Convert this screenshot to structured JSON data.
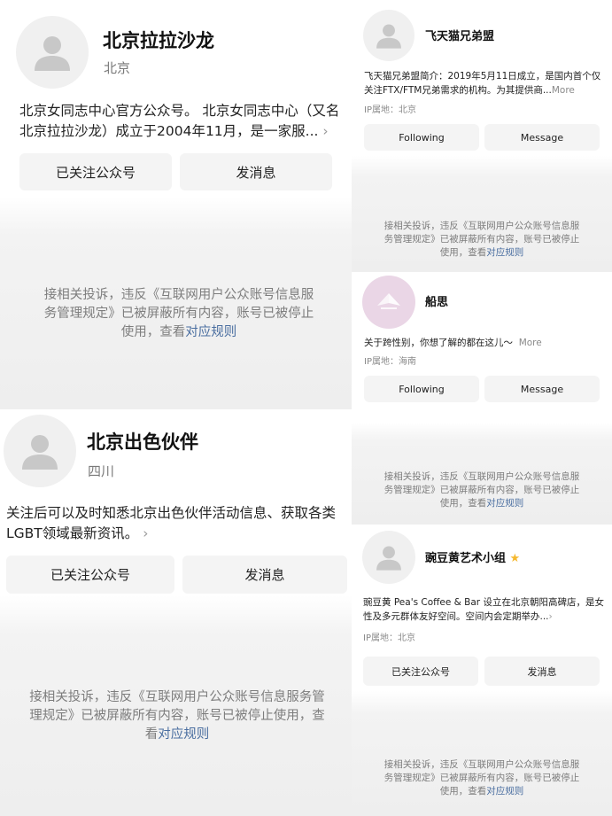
{
  "colors": {
    "link": "#4a6ea0",
    "star": "#f5b82e",
    "notice_bg": "#eeeeee"
  },
  "accounts": [
    {
      "name": "北京拉拉沙龙",
      "region": "北京",
      "description": "北京女同志中心官方公众号。 北京女同志中心（又名北京拉拉沙龙）成立于2004年11月，是一家服...",
      "follow_label": "已关注公众号",
      "message_label": "发消息",
      "notice_text": "接相关投诉，违反《互联网用户公众账号信息服务管理规定》已被屏蔽所有内容，账号已被停止使用，查看",
      "notice_link": "对应规则"
    },
    {
      "name": "北京出色伙伴",
      "region": "四川",
      "description": "关注后可以及时知悉北京出色伙伴活动信息、获取各类LGBT领域最新资讯。",
      "follow_label": "已关注公众号",
      "message_label": "发消息",
      "notice_text": "接相关投诉，违反《互联网用户公众账号信息服务管理规定》已被屏蔽所有内容，账号已被停止使用，查看",
      "notice_link": "对应规则"
    },
    {
      "name": "飞天猫兄弟盟",
      "description": "飞天猫兄弟盟简介：2019年5月11日成立，是国内首个仅关注FTX/FTM兄弟需求的机构。为其提供商...",
      "more": "More",
      "ip_label": "IP属地：北京",
      "follow_label": "Following",
      "message_label": "Message",
      "notice_text": "接相关投诉，违反《互联网用户公众账号信息服务管理规定》已被屏蔽所有内容，账号已被停止使用，查看",
      "notice_link": "对应规则"
    },
    {
      "name": "船思",
      "description": "关于跨性别，你想了解的都在这儿～",
      "more": "More",
      "ip_label": "IP属地：海南",
      "follow_label": "Following",
      "message_label": "Message",
      "notice_text": "接相关投诉，违反《互联网用户公众账号信息服务管理规定》已被屏蔽所有内容，账号已被停止使用，查看",
      "notice_link": "对应规则"
    },
    {
      "name": "豌豆黄艺术小组",
      "description": "豌豆黄 Pea's Coffee & Bar 设立在北京朝阳高碑店，是女性及多元群体友好空间。空间内会定期举办...",
      "ip_label": "IP属地：北京",
      "follow_label": "已关注公众号",
      "message_label": "发消息",
      "notice_text": "接相关投诉，违反《互联网用户公众账号信息服务管理规定》已被屏蔽所有内容，账号已被停止使用，查看",
      "notice_link": "对应规则"
    }
  ]
}
